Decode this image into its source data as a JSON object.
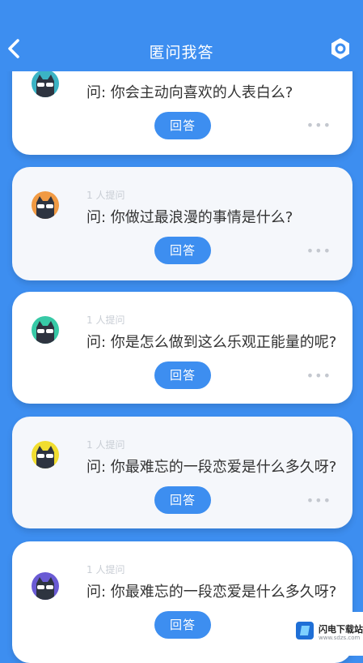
{
  "header": {
    "title": "匿问我答",
    "back_icon": "chevron-left-icon",
    "settings_icon": "hexagon-settings-icon"
  },
  "cards": [
    {
      "asker": "",
      "question": "问: 你会主动向喜欢的人表白么?",
      "answer_label": "回答",
      "more": "•••",
      "avatar_color": "#3bb3c4"
    },
    {
      "asker": "1 人提问",
      "question": "问: 你做过最浪漫的事情是什么?",
      "answer_label": "回答",
      "more": "•••",
      "avatar_color": "#f19a43"
    },
    {
      "asker": "1 人提问",
      "question": "问: 你是怎么做到这么乐观正能量的呢?",
      "answer_label": "回答",
      "more": "•••",
      "avatar_color": "#37c9a6"
    },
    {
      "asker": "1 人提问",
      "question": "问: 你最难忘的一段恋爱是什么多久呀?",
      "answer_label": "回答",
      "more": "•••",
      "avatar_color": "#f1dd2f"
    },
    {
      "asker": "1 人提问",
      "question": "问: 你最难忘的一段恋爱是什么多久呀?",
      "answer_label": "回答",
      "more": "•••",
      "avatar_color": "#6a5bd4"
    }
  ],
  "watermark": {
    "title": "闪电下载站",
    "subtitle": "www.sdzs.com"
  }
}
